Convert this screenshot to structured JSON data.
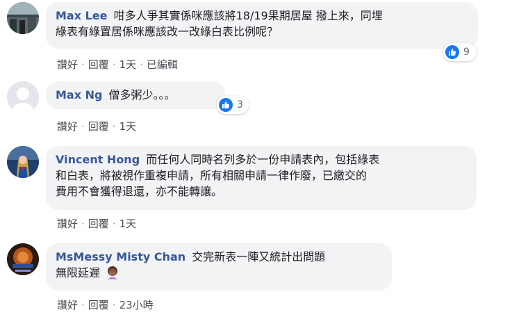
{
  "comments": [
    {
      "author": "Max Lee",
      "text_line1": "咁多人爭其實係咪應該將18/19果期居屋 撥上來，同埋",
      "text_line2": "綠表有綠置居係咪應該改一改綠白表比例呢？",
      "reactions": "9",
      "actions": {
        "like": "讚好",
        "reply": "回覆",
        "time": "1天",
        "edited": "已編輯"
      }
    },
    {
      "author": "Max Ng",
      "text_line1": "僧多粥少。。。",
      "reactions": "3",
      "actions": {
        "like": "讚好",
        "reply": "回覆",
        "time": "1天"
      }
    },
    {
      "author": "Vincent Hong",
      "text_line1": "而任何人同時名列多於一份申請表內，包括綠表",
      "text_line2": "和白表，將被視作重複申請，所有相關申請一律作廢，已繳交的",
      "text_line3": "費用不會獲得退還，亦不能轉讓。",
      "actions": {
        "like": "讚好",
        "reply": "回覆",
        "time": "1天"
      }
    },
    {
      "author": "MsMessy Misty Chan",
      "text_line1": "交完新表一陣又統計出問題",
      "text_line2": "無限延遲",
      "actions": {
        "like": "讚好",
        "reply": "回覆",
        "time": "23小時"
      }
    }
  ],
  "separator": "·",
  "colors": {
    "author": "#385898",
    "bubble": "#f2f3f5",
    "like": "#1877f2",
    "action": "#4b4f56"
  },
  "icons": [
    "like-icon",
    "facepalm-emoji",
    "avatar-photo",
    "default-avatar-icon"
  ]
}
